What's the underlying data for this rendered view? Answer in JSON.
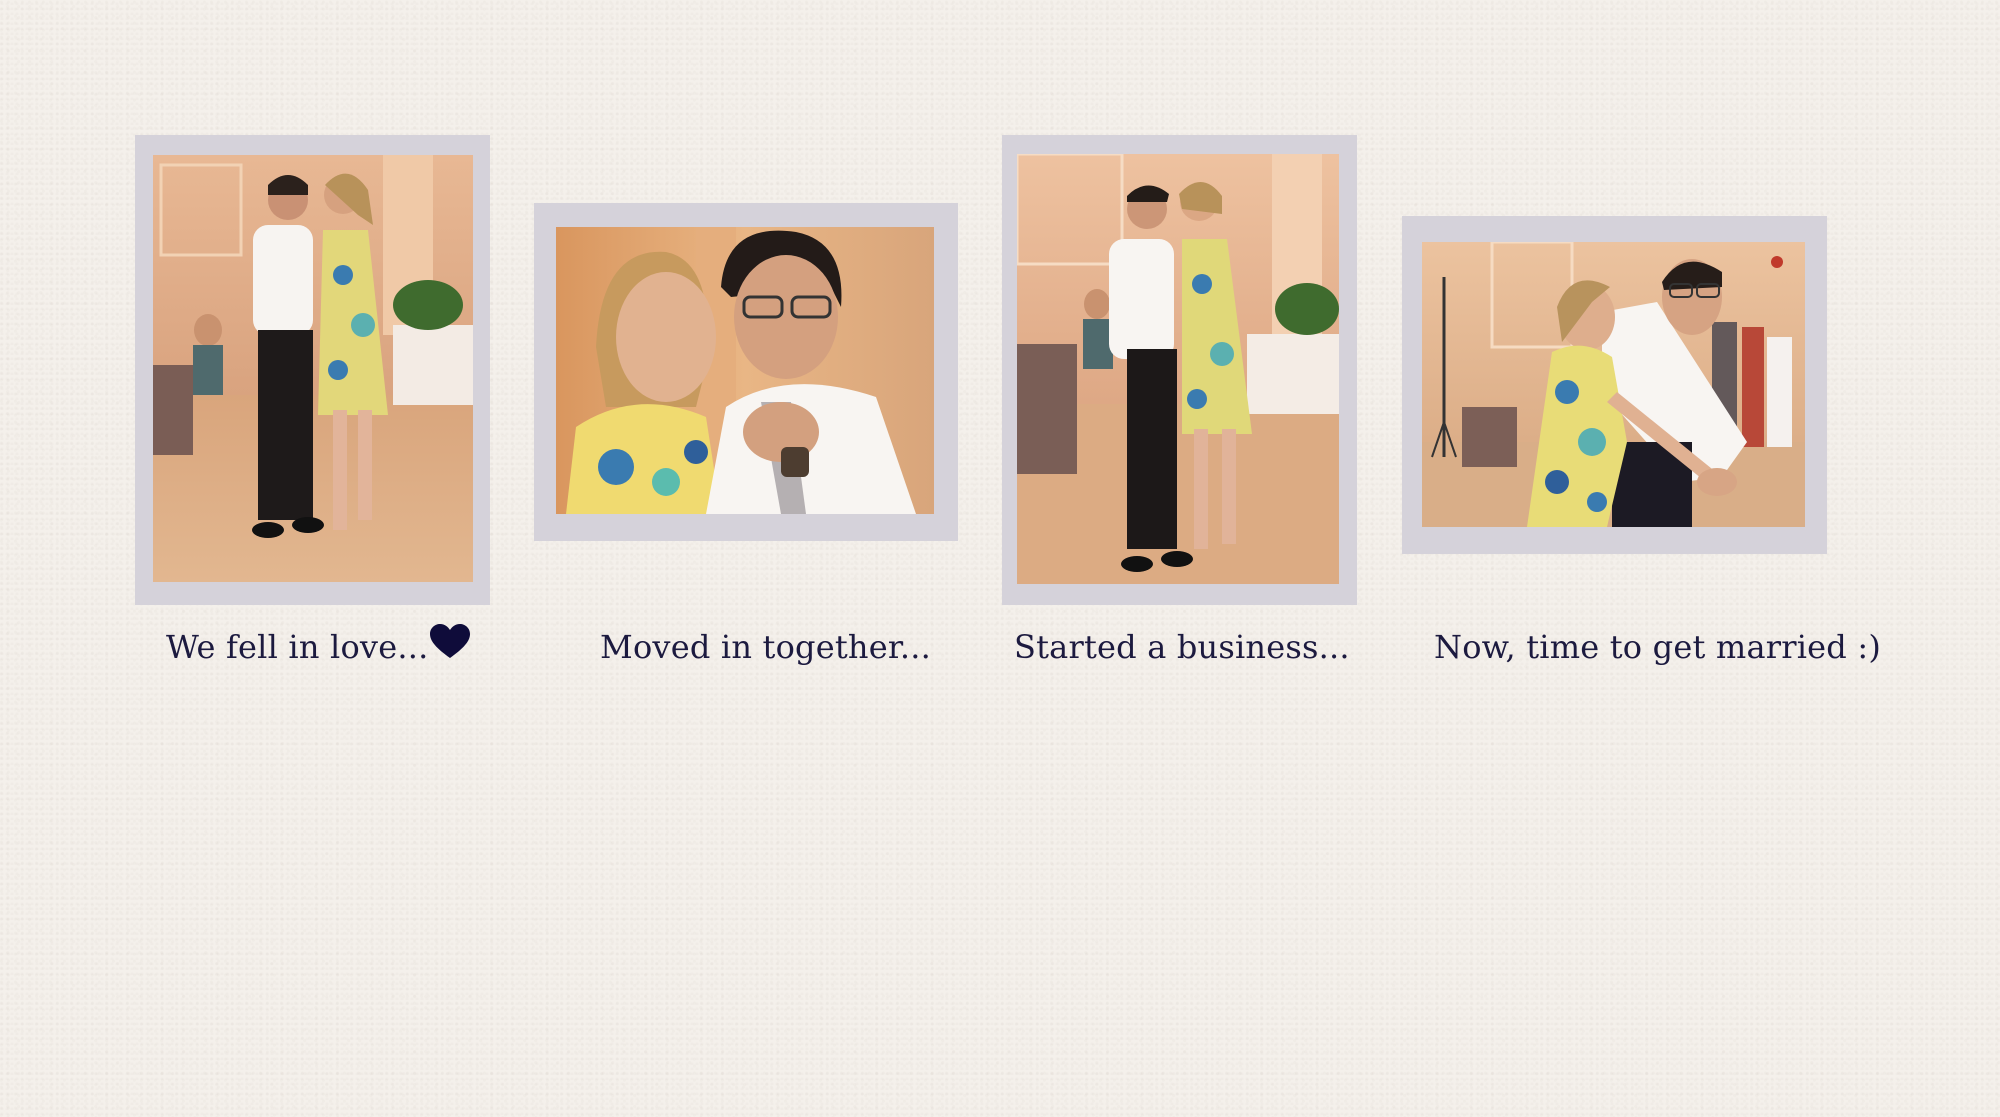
{
  "timeline": [
    {
      "photo_alt": "photo-couple-dancing-1",
      "caption": "We fell in love...",
      "icon": "heart-icon"
    },
    {
      "photo_alt": "photo-couple-closeup",
      "caption": "Moved in together..."
    },
    {
      "photo_alt": "photo-couple-dancing-2",
      "caption": "Started a business..."
    },
    {
      "photo_alt": "photo-couple-dip",
      "caption": "Now, time to get married :)"
    }
  ],
  "colors": {
    "background": "#f4f0eb",
    "frame": "#d5d2da",
    "caption_text": "#1c1a3f",
    "heart": "#0f0c3a"
  }
}
